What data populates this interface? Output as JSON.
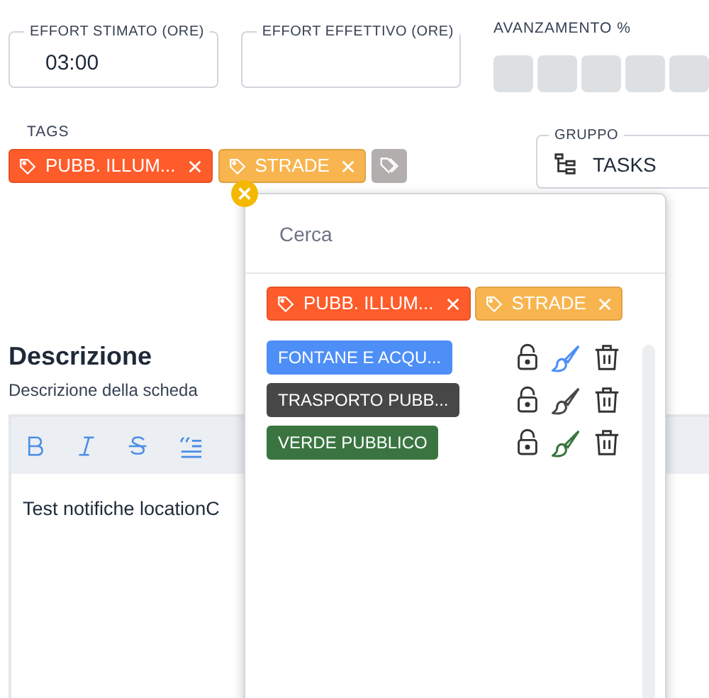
{
  "fields": [
    {
      "label": "EFFORT STIMATO (ORE)",
      "value": "03:00"
    },
    {
      "label": "EFFORT EFFETTIVO (ORE)"
    }
  ],
  "progress": {
    "label": "AVANZAMENTO %"
  },
  "tags": {
    "label": "TAGS",
    "items": [
      {
        "text": "PUBB. ILLUM...",
        "color": "#ff5c2b"
      },
      {
        "text": "STRADE",
        "color": "#f8b54f"
      }
    ]
  },
  "group": {
    "label": "GRUPPO",
    "value": "TASKS"
  },
  "description": {
    "title": "Descrizione",
    "subtitle": "Descrizione della scheda",
    "content": "Test notifiche locationC"
  },
  "dropdown": {
    "placeholder": "Cerca",
    "selected": [
      {
        "text": "PUBB. ILLUM...",
        "color": "#ff5c2b"
      },
      {
        "text": "STRADE",
        "color": "#f8b54f"
      }
    ],
    "options": [
      {
        "text": "FONTANE E ACQU...",
        "color": "#4d8ef7"
      },
      {
        "text": "TRASPORTO PUBB...",
        "color": "#474747"
      },
      {
        "text": "VERDE PUBBLICO",
        "color": "#3a7541"
      }
    ]
  }
}
